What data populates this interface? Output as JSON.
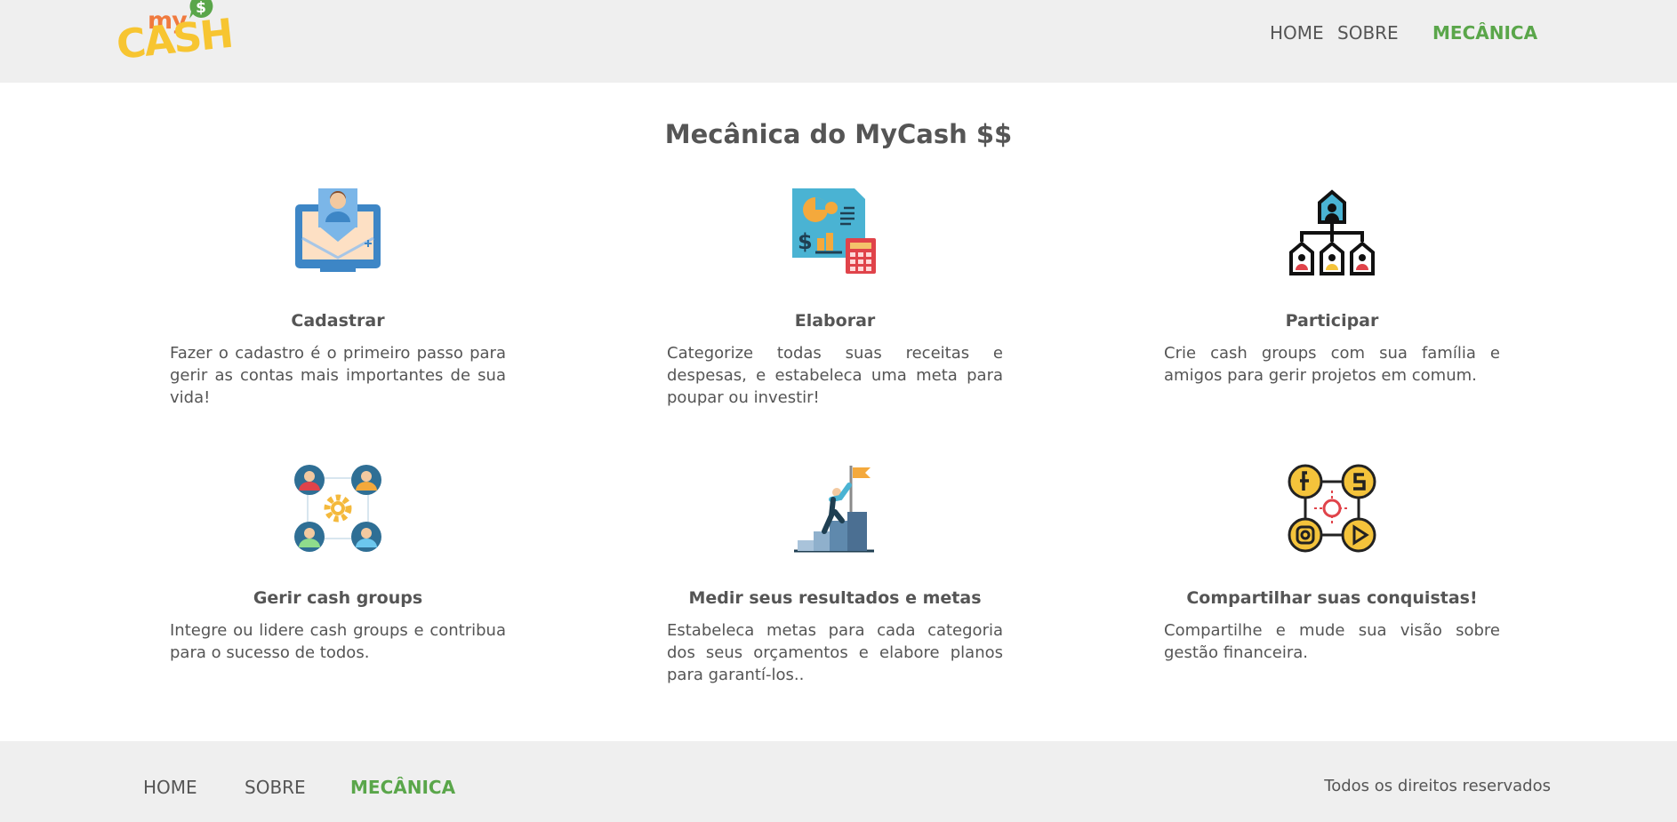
{
  "brand": {
    "logo_text_top": "my",
    "logo_text_bottom": "CASH",
    "logo_symbol": "$"
  },
  "header": {
    "nav": [
      {
        "label": "HOME",
        "active": false
      },
      {
        "label": "SOBRE",
        "active": false
      },
      {
        "label": "MECÂNICA",
        "active": true
      }
    ]
  },
  "main": {
    "title": "Mecânica do MyCash $$",
    "cards": [
      {
        "icon": "monitor-user-icon",
        "title": "Cadastrar",
        "description": "Fazer o cadastro é o primeiro passo para gerir as contas mais importantes de sua vida!"
      },
      {
        "icon": "finance-report-icon",
        "title": "Elaborar",
        "description": "Categorize todas suas receitas e despesas, e estabeleca uma meta para poupar ou investir!"
      },
      {
        "icon": "group-hierarchy-icon",
        "title": "Participar",
        "description": "Crie cash groups com sua família e amigos para gerir projetos em comum."
      },
      {
        "icon": "team-network-icon",
        "title": "Gerir cash groups",
        "description": "Integre ou lidere cash groups e contribua para o sucesso de todos."
      },
      {
        "icon": "goal-flag-icon",
        "title": "Medir seus resultados e metas",
        "description": "Estabeleca metas para cada categoria dos seus orçamentos e elabore planos para garantí-los.."
      },
      {
        "icon": "social-share-icon",
        "title": "Compartilhar suas conquistas!",
        "description": "Compartilhe e mude sua visão sobre gestão financeira."
      }
    ]
  },
  "footer": {
    "nav": [
      {
        "label": "HOME",
        "active": false
      },
      {
        "label": "SOBRE",
        "active": false
      },
      {
        "label": "MECÂNICA",
        "active": true
      }
    ],
    "rights": "Todos os direitos reservados"
  },
  "colors": {
    "accent": "#5aa64a",
    "text": "#555555",
    "bar": "#efefef"
  }
}
